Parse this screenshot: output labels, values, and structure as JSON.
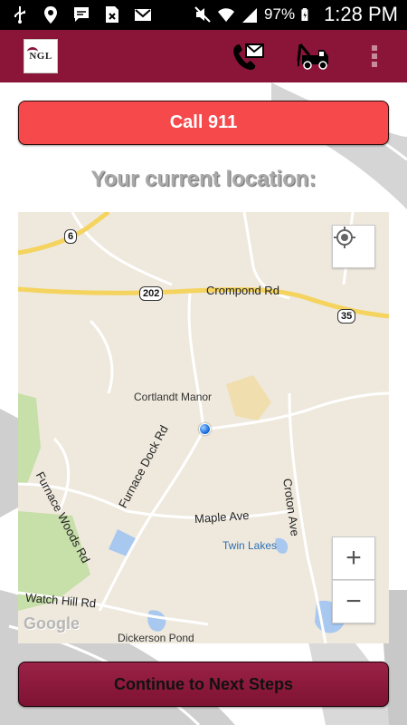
{
  "status_bar": {
    "battery": "97%",
    "time": "1:28 PM"
  },
  "app_bar": {
    "logo_text": "NGL",
    "icons": [
      "phone-email-icon",
      "tow-truck-icon",
      "overflow-menu-icon"
    ]
  },
  "main": {
    "call_button": "Call 911",
    "location_heading": "Your current location:",
    "continue_button": "Continue to Next Steps"
  },
  "map": {
    "labels": {
      "route6": "6",
      "route202": "202",
      "route35": "35",
      "crompond": "Crompond Rd",
      "cortlandt": "Cortlandt Manor",
      "furnace_dock": "Furnace Dock Rd",
      "furnace_woods": "Furnace Woods Rd",
      "maple": "Maple Ave",
      "croton": "Croton Ave",
      "twin_lakes": "Twin Lakes",
      "watch_hill": "Watch Hill Rd",
      "dickerson": "Dickerson Pond",
      "google": "Google"
    },
    "zoom_in": "+",
    "zoom_out": "−"
  },
  "colors": {
    "brand": "#8a1538",
    "call_red": "#f5494b",
    "map_bg": "#efe9dd",
    "highway": "#f4d35e"
  }
}
